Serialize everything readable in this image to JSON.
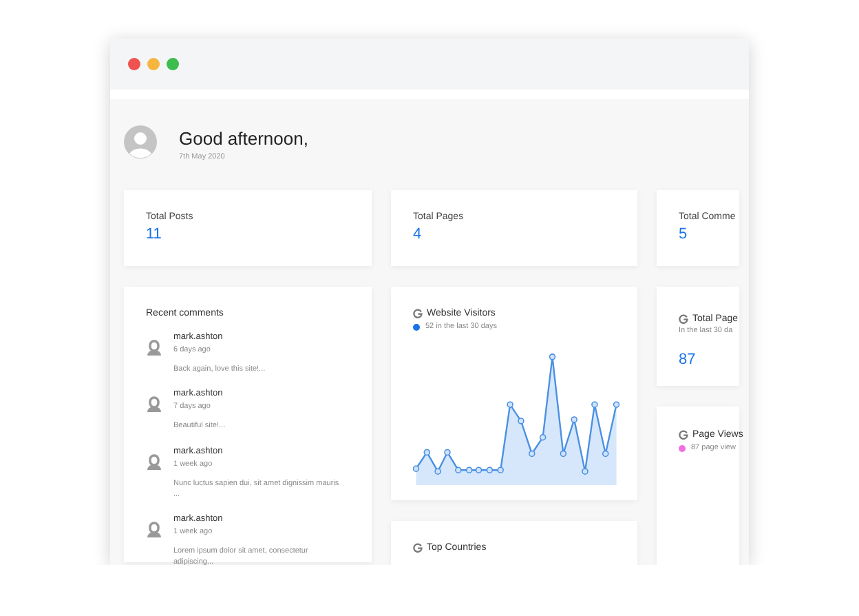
{
  "window": {
    "controls": [
      {
        "color": "#f0524f"
      },
      {
        "color": "#f5b53f"
      },
      {
        "color": "#3dbd4e"
      }
    ]
  },
  "header": {
    "greeting": "Good afternoon,",
    "date": "7th May 2020"
  },
  "stats": [
    {
      "label": "Total Posts",
      "value": "11"
    },
    {
      "label": "Total Pages",
      "value": "4"
    },
    {
      "label": "Total Comme",
      "value": "5"
    }
  ],
  "recent_comments": {
    "title": "Recent comments",
    "items": [
      {
        "author": "mark.ashton",
        "time": "6 days ago",
        "text": "Back again, love this site!..."
      },
      {
        "author": "mark.ashton",
        "time": "7 days ago",
        "text": "Beautiful site!..."
      },
      {
        "author": "mark.ashton",
        "time": "1 week ago",
        "text": "Nunc luctus sapien dui, sit amet dignissim mauris ..."
      },
      {
        "author": "mark.ashton",
        "time": "1 week ago",
        "text": "Lorem ipsum dolor sit amet, consectetur adipiscing..."
      }
    ]
  },
  "visitors": {
    "title": "Website Visitors",
    "legend": "52 in the last 30 days"
  },
  "top_countries": {
    "title": "Top Countries"
  },
  "total_page_views": {
    "title": "Total Page",
    "subtitle": "In the last 30 da",
    "value": "87"
  },
  "page_views": {
    "title": "Page Views",
    "legend": "87 page view"
  }
}
